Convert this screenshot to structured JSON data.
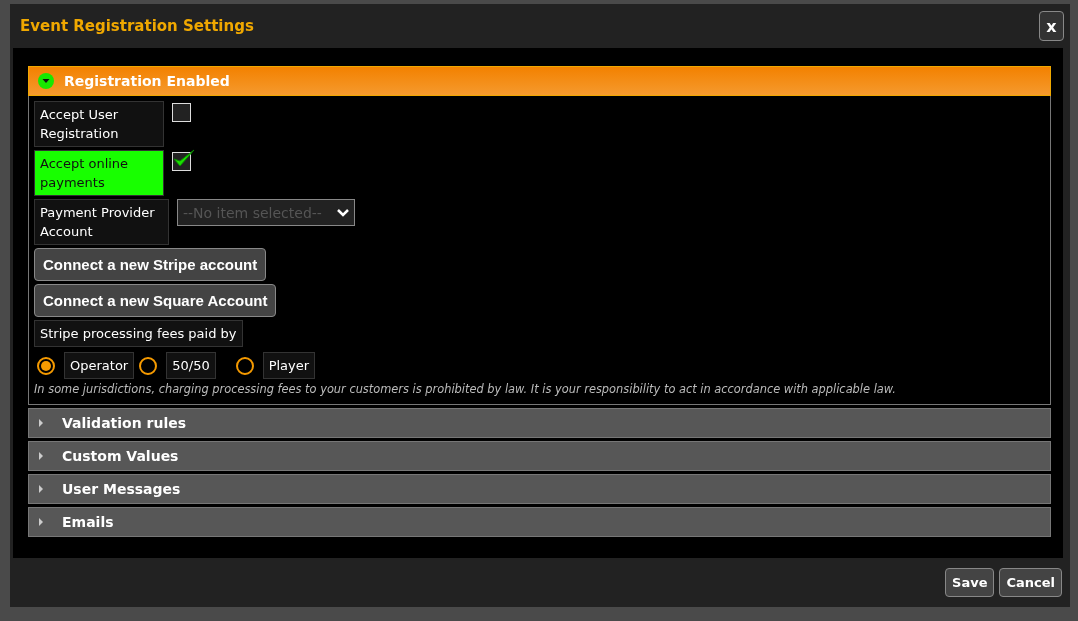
{
  "dialog": {
    "title": "Event Registration Settings",
    "close_label": "x"
  },
  "sections": [
    {
      "title": "Registration Enabled",
      "expanded": true,
      "fields": [
        {
          "kind": "checkbox",
          "label": "Accept User Registration",
          "checked": false
        },
        {
          "kind": "checkbox",
          "label": "Accept online payments",
          "checked": true
        },
        {
          "kind": "select",
          "label": "Payment Provider Account",
          "placeholder": "--No item selected--"
        }
      ],
      "buttons": [
        "Connect a new Stripe account",
        "Connect a new Square Account"
      ],
      "fee_group": {
        "label": "Stripe processing fees paid by",
        "options": [
          {
            "label": "Operator",
            "selected": true
          },
          {
            "label": "50/50",
            "selected": false
          },
          {
            "label": "Player",
            "selected": false
          }
        ]
      },
      "note": "In some jurisdictions, charging processing fees to your customers is prohibited by law. It is your responsibility to act in accordance with applicable law."
    },
    {
      "title": "Validation rules",
      "expanded": false
    },
    {
      "title": "Custom Values",
      "expanded": false
    },
    {
      "title": "User Messages",
      "expanded": false
    },
    {
      "title": "Emails",
      "expanded": false
    }
  ],
  "footer_buttons": [
    "Save",
    "Cancel"
  ]
}
